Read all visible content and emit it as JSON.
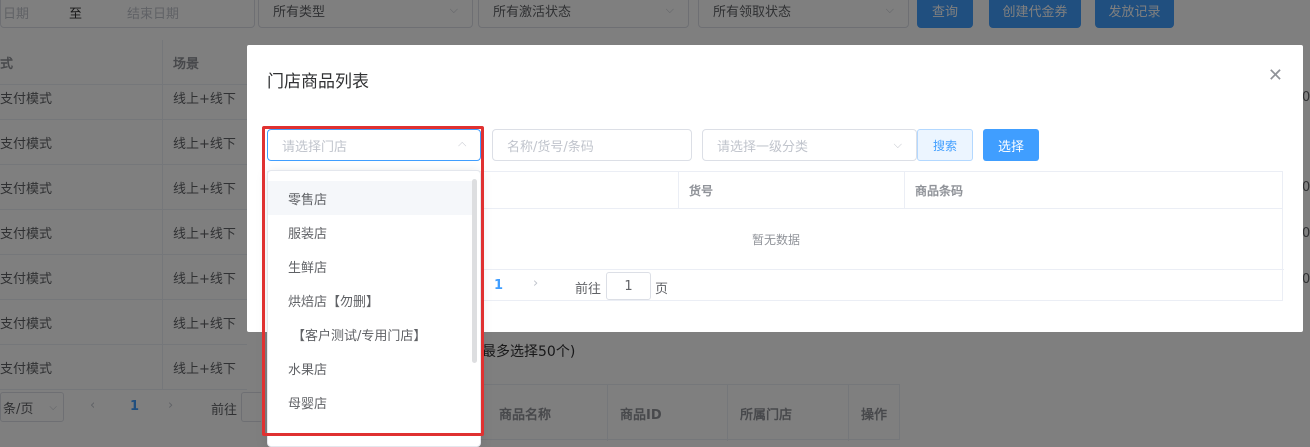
{
  "filters": {
    "start_date": "日期",
    "to": "至",
    "end_date": "结束日期",
    "type": "所有类型",
    "activation": "所有激活状态",
    "claim": "所有领取状态",
    "query_btn": "查询",
    "create_btn": "创建代金券",
    "records_btn": "发放记录"
  },
  "bg_table": {
    "headers": [
      "式",
      "场景"
    ],
    "rows": [
      [
        "支付模式",
        "线上+线下"
      ],
      [
        "支付模式",
        "线上+线下"
      ],
      [
        "支付模式",
        "线上+线下"
      ],
      [
        "支付模式",
        "线上+线下"
      ],
      [
        "支付模式",
        "线上+线下"
      ],
      [
        "支付模式",
        "线上+线下"
      ],
      [
        "支付模式",
        "线上+线下"
      ]
    ],
    "right_edge": "0",
    "pager": {
      "per_page": "条/页",
      "current": "1",
      "goto": "前往"
    }
  },
  "modal": {
    "title": "门店商品列表",
    "store_placeholder": "请选择门店",
    "keyword_placeholder": "名称/货号/条码",
    "category_placeholder": "请选择一级分类",
    "search_btn": "搜索",
    "select_btn": "选择",
    "columns": [
      "货号",
      "商品条码"
    ],
    "empty": "暂无数据",
    "pager": {
      "current": "1",
      "goto": "前往",
      "page_value": "1",
      "page_suffix": "页"
    }
  },
  "dropdown": {
    "options": [
      "零售店",
      "服装店",
      "生鲜店",
      "烘焙店【勿删】",
      "【客户测试/专用门店】",
      "水果店",
      "母婴店"
    ]
  },
  "selection": {
    "tip": "最多选择50个)",
    "columns": [
      "商品名称",
      "商品ID",
      "所属门店",
      "操作"
    ]
  }
}
